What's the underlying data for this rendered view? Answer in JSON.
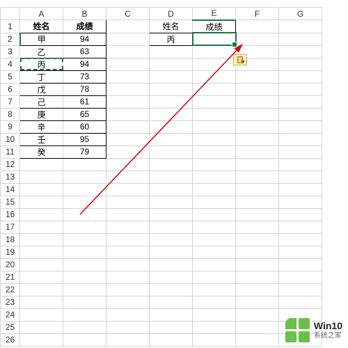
{
  "columns": [
    "A",
    "B",
    "C",
    "D",
    "E",
    "F",
    "G"
  ],
  "rowcount": 26,
  "table1": {
    "header_name": "姓名",
    "header_score": "成绩",
    "rows": [
      {
        "name": "甲",
        "score": "94"
      },
      {
        "name": "乙",
        "score": "63"
      },
      {
        "name": "丙",
        "score": "94"
      },
      {
        "name": "丁",
        "score": "73"
      },
      {
        "name": "戊",
        "score": "78"
      },
      {
        "name": "己",
        "score": "61"
      },
      {
        "name": "庚",
        "score": "65"
      },
      {
        "name": "辛",
        "score": "60"
      },
      {
        "name": "壬",
        "score": "95"
      },
      {
        "name": "癸",
        "score": "79"
      }
    ]
  },
  "table2": {
    "header_name": "姓名",
    "header_score": "成绩",
    "cell_d2": "丙",
    "cell_e2": ""
  },
  "copy_source": "A4",
  "active_cell": "E2",
  "watermark": {
    "line1": "Win10",
    "line2": "系统之家"
  }
}
